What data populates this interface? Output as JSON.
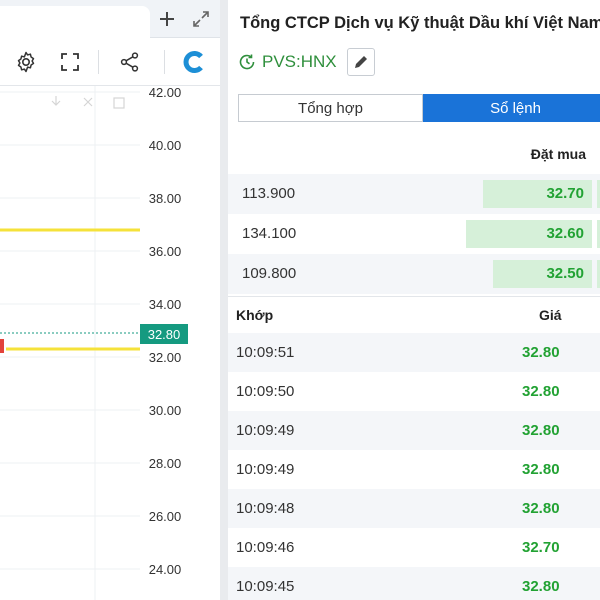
{
  "chart": {
    "price_axis": [
      "42.00",
      "40.00",
      "38.00",
      "36.00",
      "34.00",
      "32.00",
      "30.00",
      "28.00",
      "26.00",
      "24.00"
    ],
    "current_price": "32.80",
    "colors": {
      "level_line": "#f5e23a",
      "price_tag": "#159a80",
      "axis_text": "#333333",
      "grid": "#eef0f3"
    }
  },
  "header": {
    "company_name": "Tổng CTCP Dịch vụ Kỹ thuật Dầu khí Việt Nam",
    "ticker": "PVS:HNX"
  },
  "tabs": [
    {
      "label": "Tổng hợp",
      "active": false
    },
    {
      "label": "Sổ lệnh",
      "active": true
    }
  ],
  "order_book": {
    "bid_header": "Đặt mua",
    "bids": [
      {
        "volume": "113.900",
        "price": "32.70",
        "fill": 0.64
      },
      {
        "volume": "134.100",
        "price": "32.60",
        "fill": 0.74
      },
      {
        "volume": "109.800",
        "price": "32.50",
        "fill": 0.58
      }
    ]
  },
  "matches": {
    "time_header": "Khớp",
    "price_header": "Giá",
    "rows": [
      {
        "time": "10:09:51",
        "price": "32.80"
      },
      {
        "time": "10:09:50",
        "price": "32.80"
      },
      {
        "time": "10:09:49",
        "price": "32.80"
      },
      {
        "time": "10:09:49",
        "price": "32.80"
      },
      {
        "time": "10:09:48",
        "price": "32.80"
      },
      {
        "time": "10:09:46",
        "price": "32.70"
      },
      {
        "time": "10:09:45",
        "price": "32.80"
      }
    ]
  },
  "colors": {
    "accent": "#1a73d8",
    "up": "#22a233",
    "bid_fill": "#d6f0d9",
    "row_alt": "#f4f6f9"
  }
}
